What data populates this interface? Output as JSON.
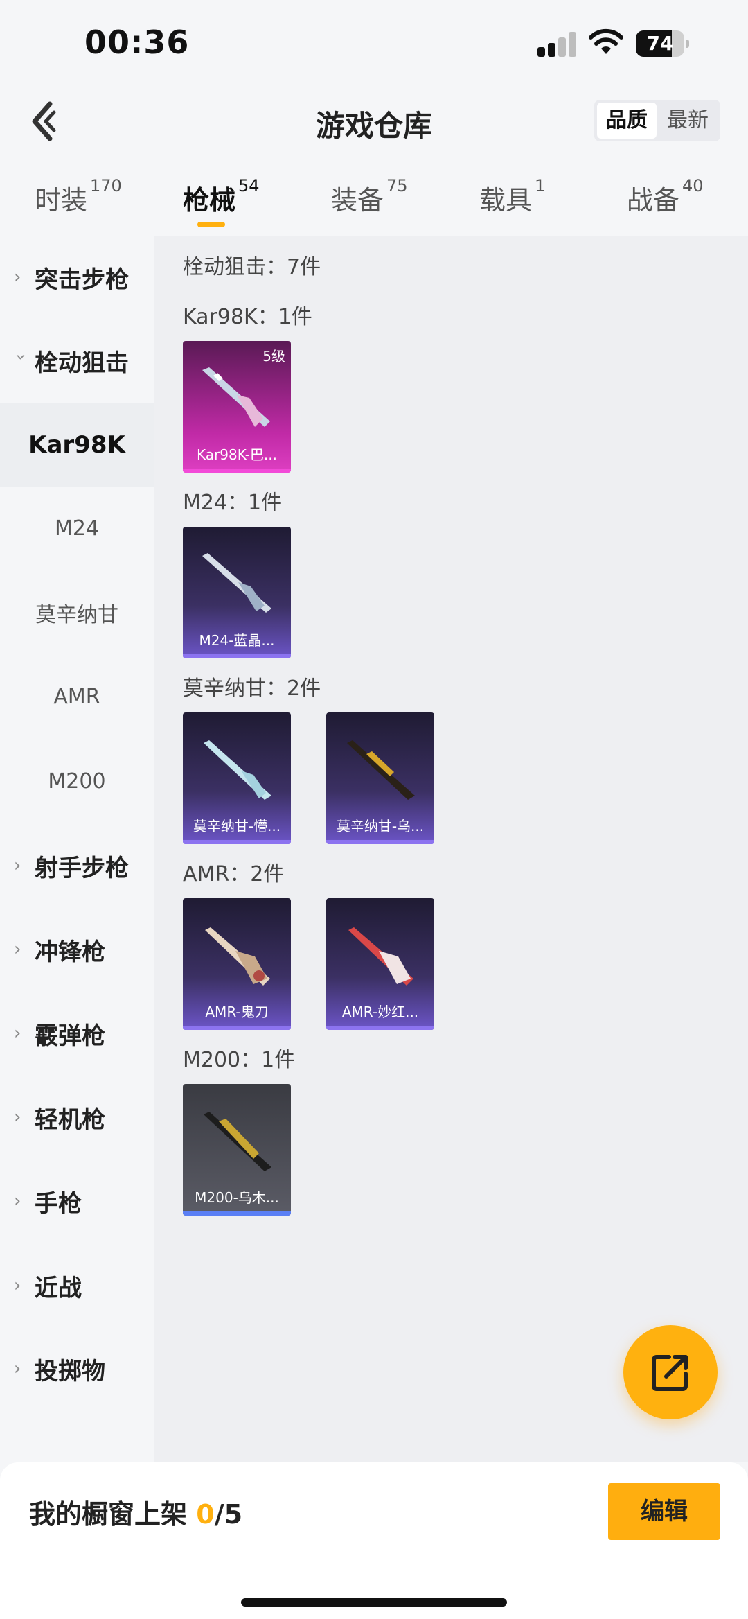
{
  "status": {
    "time": "00:36",
    "battery": "74",
    "battery_level": 0.74
  },
  "header": {
    "title": "游戏仓库",
    "sort_quality": "品质",
    "sort_latest": "最新"
  },
  "tabs": [
    {
      "label": "时装",
      "count": "170"
    },
    {
      "label": "枪械",
      "count": "54"
    },
    {
      "label": "装备",
      "count": "75"
    },
    {
      "label": "载具",
      "count": "1"
    },
    {
      "label": "战备",
      "count": "40"
    }
  ],
  "sidebar": {
    "items": [
      {
        "label": "突击步枪"
      },
      {
        "label": "栓动狙击"
      },
      {
        "label": "Kar98K"
      },
      {
        "label": "M24"
      },
      {
        "label": "莫辛纳甘"
      },
      {
        "label": "AMR"
      },
      {
        "label": "M200"
      },
      {
        "label": "射手步枪"
      },
      {
        "label": "冲锋枪"
      },
      {
        "label": "霰弹枪"
      },
      {
        "label": "轻机枪"
      },
      {
        "label": "手枪"
      },
      {
        "label": "近战"
      },
      {
        "label": "投掷物"
      }
    ]
  },
  "content": {
    "summary": "栓动狙击：7件",
    "groups": [
      {
        "heading": "Kar98K：1件",
        "items": [
          {
            "name": "Kar98K-巴...",
            "level": "5级"
          }
        ]
      },
      {
        "heading": "M24：1件",
        "items": [
          {
            "name": "M24-蓝晶..."
          }
        ]
      },
      {
        "heading": "莫辛纳甘：2件",
        "items": [
          {
            "name": "莫辛纳甘-懵..."
          },
          {
            "name": "莫辛纳甘-乌..."
          }
        ]
      },
      {
        "heading": "AMR：2件",
        "items": [
          {
            "name": "AMR-鬼刀"
          },
          {
            "name": "AMR-妙红..."
          }
        ]
      },
      {
        "heading": "M200：1件",
        "items": [
          {
            "name": "M200-乌木..."
          }
        ]
      }
    ]
  },
  "bottom": {
    "showcase_label": "我的橱窗上架",
    "showcase_count": "0",
    "showcase_total": "/5",
    "edit_label": "编辑"
  },
  "colors": {
    "accent": "#ffb00f",
    "epic": "#c02aa6",
    "rare": "#6c55c8"
  }
}
